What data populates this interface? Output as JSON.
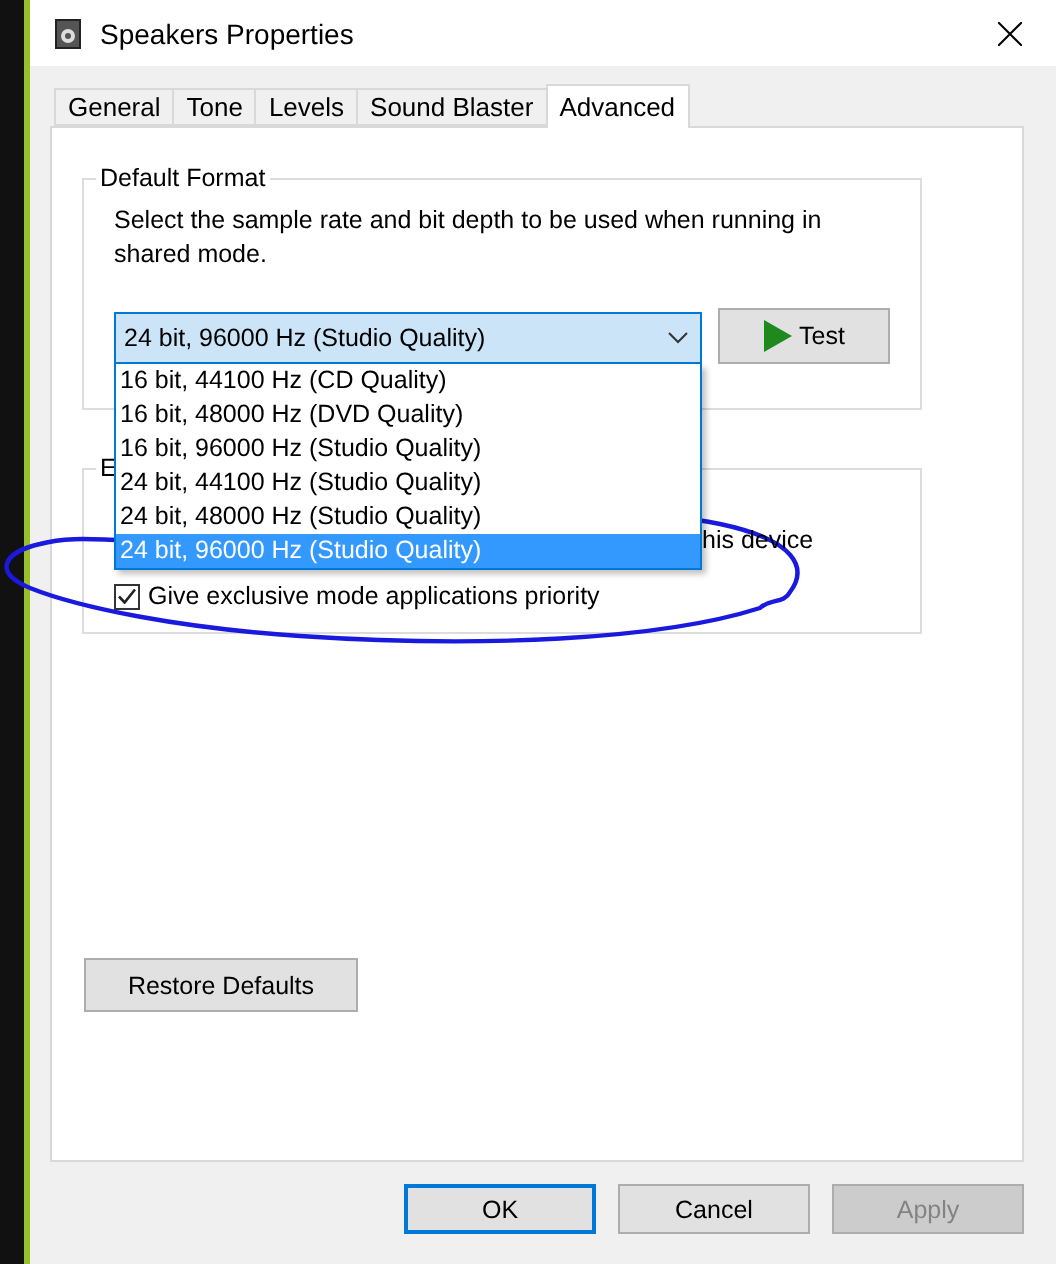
{
  "window": {
    "title": "Speakers Properties"
  },
  "tabs": [
    {
      "label": "General",
      "selected": false
    },
    {
      "label": "Tone",
      "selected": false
    },
    {
      "label": "Levels",
      "selected": false
    },
    {
      "label": "Sound Blaster",
      "selected": false
    },
    {
      "label": "Advanced",
      "selected": true
    }
  ],
  "default_format": {
    "title": "Default Format",
    "description": "Select the sample rate and bit depth to be used when running in shared mode.",
    "dropdown": {
      "value": "24 bit, 96000 Hz (Studio Quality)",
      "expanded": true,
      "options": [
        {
          "label": "16 bit, 44100 Hz (CD Quality)",
          "selected": false
        },
        {
          "label": "16 bit, 48000 Hz (DVD Quality)",
          "selected": false
        },
        {
          "label": "16 bit, 96000 Hz (Studio Quality)",
          "selected": false
        },
        {
          "label": "24 bit, 44100 Hz (Studio Quality)",
          "selected": false
        },
        {
          "label": "24 bit, 48000 Hz (Studio Quality)",
          "selected": false
        },
        {
          "label": "24 bit, 96000 Hz (Studio Quality)",
          "selected": true
        }
      ]
    },
    "test_button": "Test"
  },
  "exclusive_mode": {
    "title": "E",
    "partial_text": "his device",
    "checkbox": {
      "label": "Give exclusive mode applications priority",
      "checked": true
    }
  },
  "restore_button": "Restore Defaults",
  "buttons": [
    {
      "label": "OK",
      "default": true,
      "disabled": false
    },
    {
      "label": "Cancel",
      "default": false,
      "disabled": false
    },
    {
      "label": "Apply",
      "default": false,
      "disabled": true
    }
  ]
}
